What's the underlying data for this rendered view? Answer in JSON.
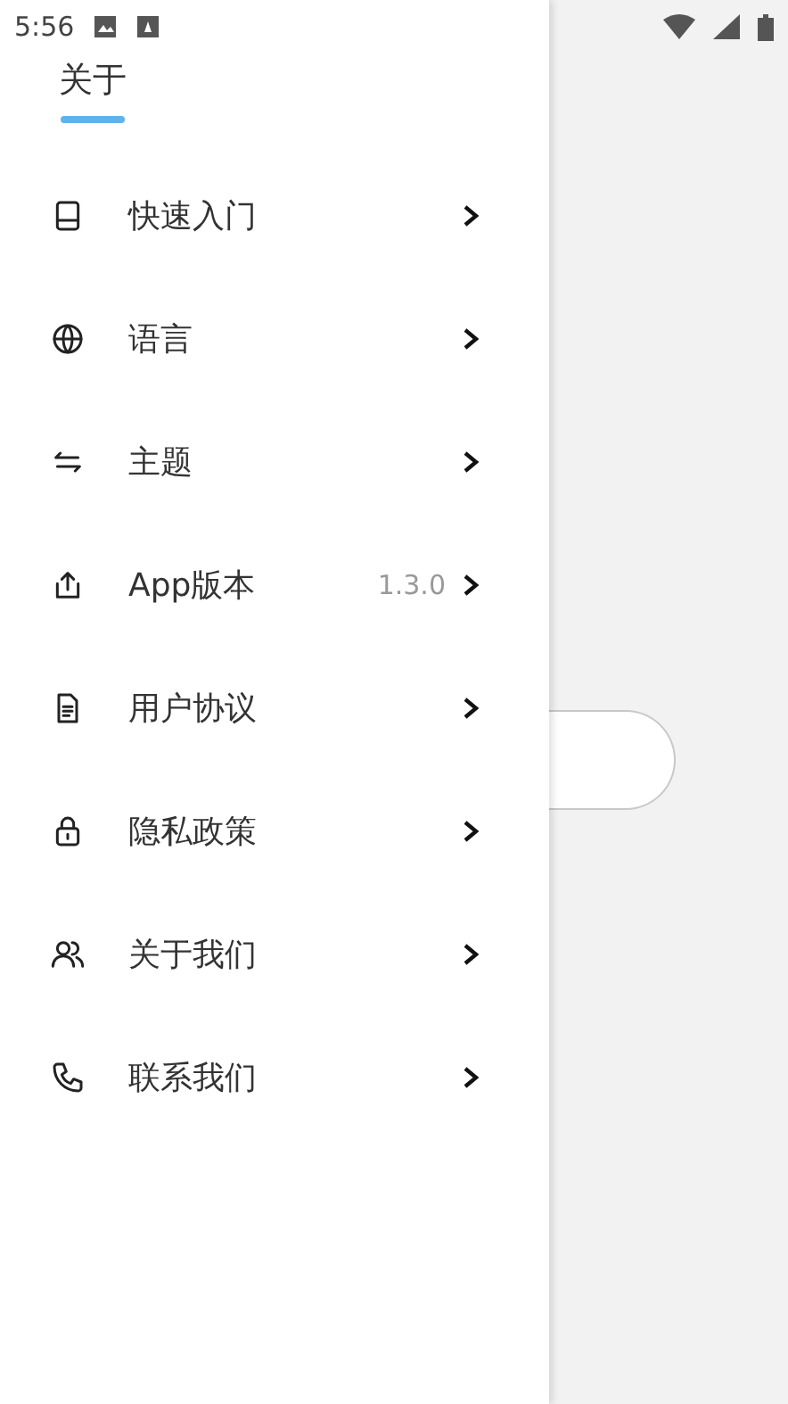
{
  "status_bar": {
    "time": "5:56"
  },
  "tabs": [
    {
      "label": "关于",
      "selected": true
    }
  ],
  "menu": [
    {
      "label": "快速入门"
    },
    {
      "label": "语言"
    },
    {
      "label": "主题"
    },
    {
      "label": "App版本",
      "value": "1.3.0"
    },
    {
      "label": "用户协议"
    },
    {
      "label": "隐私政策"
    },
    {
      "label": "关于我们"
    },
    {
      "label": "联系我们"
    }
  ]
}
